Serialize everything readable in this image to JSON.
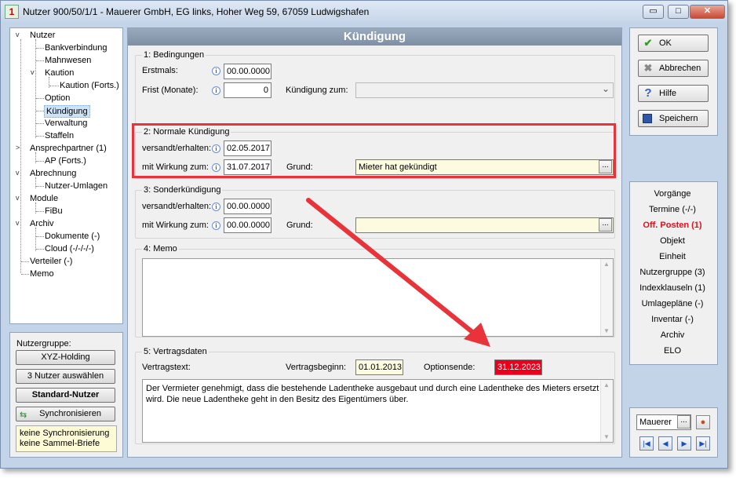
{
  "window": {
    "title": "Nutzer 900/50/1/1 - Mauerer GmbH, EG links, Hoher Weg 59, 67059 Ludwigshafen",
    "icon_text": "1",
    "btn_min": "▭",
    "btn_max": "□",
    "btn_close": "✕"
  },
  "tree": {
    "items": [
      {
        "label": "Nutzer"
      },
      {
        "label": "Bankverbindung"
      },
      {
        "label": "Mahnwesen"
      },
      {
        "label": "Kaution"
      },
      {
        "label": "Kaution (Forts.)"
      },
      {
        "label": "Option"
      },
      {
        "label": "Kündigung"
      },
      {
        "label": "Verwaltung"
      },
      {
        "label": "Staffeln"
      },
      {
        "label": "Ansprechpartner (1)"
      },
      {
        "label": "AP (Forts.)"
      },
      {
        "label": "Abrechnung"
      },
      {
        "label": "Nutzer-Umlagen"
      },
      {
        "label": "Module"
      },
      {
        "label": "FiBu"
      },
      {
        "label": "Archiv"
      },
      {
        "label": "Dokumente (-)"
      },
      {
        "label": "Cloud (-/-/-/-)"
      },
      {
        "label": "Verteiler (-)"
      },
      {
        "label": "Memo"
      }
    ]
  },
  "usergroup": {
    "label": "Nutzergruppe:",
    "group_btn": "XYZ-Holding",
    "select_btn": "3 Nutzer auswählen",
    "standard_btn": "Standard-Nutzer",
    "sync_btn": "Synchronisieren",
    "note_line1": "keine Synchronisierung",
    "note_line2": "keine Sammel-Briefe"
  },
  "form": {
    "title": "Kündigung",
    "sec1": {
      "title": "1: Bedingungen",
      "erstmals_label": "Erstmals:",
      "erstmals": "00.00.0000",
      "frist_label": "Frist (Monate):",
      "frist": "0",
      "zum_label": "Kündigung zum:",
      "zum": "",
      "chevron": "⌄"
    },
    "sec2": {
      "title": "2: Normale Kündigung",
      "versandt_label": "versandt/erhalten:",
      "versandt": "02.05.2017",
      "wirkung_label": "mit Wirkung zum:",
      "wirkung": "31.07.2017",
      "grund_label": "Grund:",
      "grund": "Mieter hat gekündigt"
    },
    "sec3": {
      "title": "3: Sonderkündigung",
      "versandt_label": "versandt/erhalten:",
      "versandt": "00.00.0000",
      "wirkung_label": "mit Wirkung zum:",
      "wirkung": "00.00.0000",
      "grund_label": "Grund:",
      "grund": ""
    },
    "sec4": {
      "title": "4: Memo",
      "text": ""
    },
    "sec5": {
      "title": "5: Vertragsdaten",
      "vertragstext_label": "Vertragstext:",
      "beginn_label": "Vertragsbeginn:",
      "beginn": "01.01.2013",
      "optionsende_label": "Optionsende:",
      "optionsende": "31.12.2023",
      "text": "Der Vermieter genehmigt, dass die bestehende Ladentheke ausgebaut und durch eine Ladentheke des Mieters ersetzt wird. Die neue Ladentheke geht in den Besitz des Eigentümers über."
    },
    "info_glyph": "i",
    "dots": "..."
  },
  "actions": {
    "ok": "OK",
    "cancel": "Abbrechen",
    "help": "Hilfe",
    "save": "Speichern"
  },
  "nav": {
    "links": [
      "Vorgänge",
      "Termine (-/-)",
      "Off. Posten (1)",
      "Objekt",
      "Einheit",
      "Nutzergruppe (3)",
      "Indexklauseln (1)",
      "Umlagepläne (-)",
      "Inventar (-)",
      "Archiv",
      "ELO"
    ]
  },
  "search": {
    "value": "Mauerer"
  },
  "colors": {
    "highlight_red": "#e8333a",
    "optionsende_bg": "#e8001c",
    "selected_bg": "#cfe3f7"
  }
}
